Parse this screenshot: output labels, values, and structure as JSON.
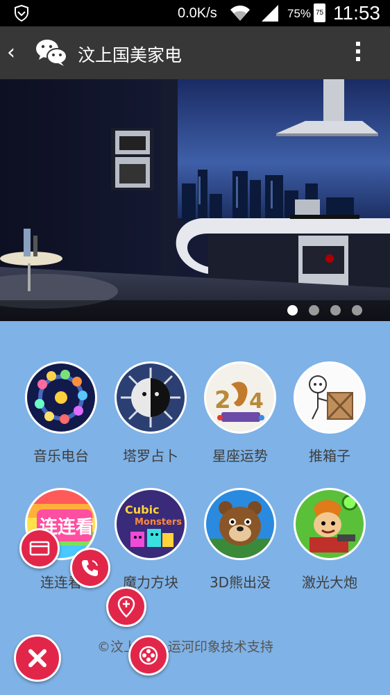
{
  "status_bar": {
    "speed": "0.0K/s",
    "battery_percent": "75%",
    "battery_icon_level": "75",
    "time": "11:53",
    "icons": [
      "shield-icon",
      "wifi-icon",
      "signal-icon",
      "battery-icon"
    ]
  },
  "app_bar": {
    "back_icon": "chevron-left-icon",
    "app_icon": "wechat-icon",
    "title": "汶上国美家电",
    "menu_icon": "more-vertical-icon"
  },
  "banner": {
    "image": "kitchen-appliances-photo",
    "page_count": 4,
    "active_page": 1
  },
  "grid": {
    "items": [
      {
        "label": "音乐电台",
        "icon": "music-radio-icon"
      },
      {
        "label": "塔罗占卜",
        "icon": "tarot-icon"
      },
      {
        "label": "星座运势",
        "icon": "horoscope-icon"
      },
      {
        "label": "推箱子",
        "icon": "push-box-game-icon"
      },
      {
        "label": "连连看",
        "icon": "link-match-game-icon"
      },
      {
        "label": "魔力方块",
        "icon": "magic-cube-game-icon"
      },
      {
        "label": "3D熊出没",
        "icon": "3d-bears-game-icon"
      },
      {
        "label": "激光大炮",
        "icon": "laser-cannon-game-icon"
      }
    ]
  },
  "footer": {
    "text": "©汶上国美-运河印象技术支持"
  },
  "fab_menu": {
    "buttons": [
      "card-icon",
      "phone-icon",
      "location-icon",
      "film-reel-icon",
      "close-icon"
    ]
  },
  "colors": {
    "background": "#7fb2e6",
    "fab": "#e2264a",
    "app_bar": "#373737"
  }
}
